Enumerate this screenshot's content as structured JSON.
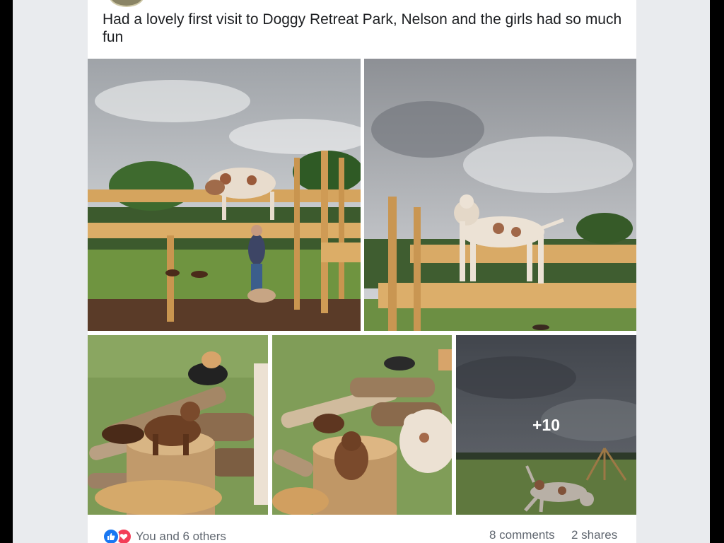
{
  "post": {
    "text": "Had a lovely first visit to Doggy Retreat Park, Nelson and the girls had so much fun",
    "more_photos_label": "+10",
    "reactions_text": "You and 6 others",
    "comments_text": "8 comments",
    "shares_text": "2 shares",
    "reaction_icons": [
      "like-icon",
      "love-icon"
    ],
    "colors": {
      "like": "#1877f2",
      "love": "#f33e58",
      "text": "#1c1e21",
      "meta": "#606770"
    }
  }
}
